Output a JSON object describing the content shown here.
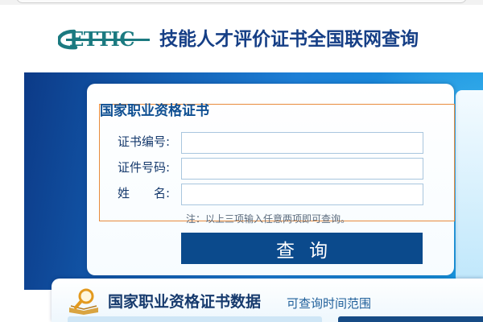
{
  "header": {
    "logo_text": "ETTIC",
    "title": "技能人才评价证书全国联网查询"
  },
  "form": {
    "title": "国家职业资格证书",
    "fields": [
      {
        "label": "证书编号:",
        "value": "",
        "placeholder": ""
      },
      {
        "label": "证件号码:",
        "value": "",
        "placeholder": ""
      },
      {
        "label": "姓　　名:",
        "value": "",
        "placeholder": ""
      }
    ],
    "note": "注：以上三项输入任意两项即可查询。",
    "submit_label": "查询"
  },
  "section2": {
    "title": "国家职业资格证书数据",
    "subtitle": "可查询时间范围"
  },
  "colors": {
    "brand_blue": "#163f86",
    "button": "#0b4a8c",
    "highlight_border": "#e88b3c",
    "logo": "#1b7a80"
  },
  "icons": [
    "logo-swoosh",
    "book-magnifier-icon"
  ]
}
